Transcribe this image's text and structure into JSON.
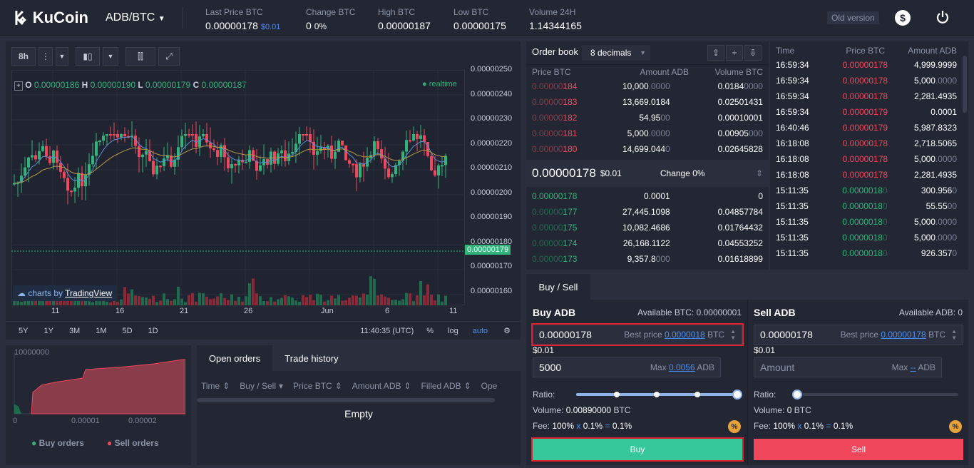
{
  "header": {
    "brand": "KuCoin",
    "pair": "ADB/BTC",
    "old_version": "Old version",
    "stats": [
      {
        "label": "Last Price BTC",
        "value": "0.00000178",
        "extra": "$0.01"
      },
      {
        "label": "Change BTC",
        "value": "0",
        "extra": "0%"
      },
      {
        "label": "High BTC",
        "value": "0.00000187"
      },
      {
        "label": "Low BTC",
        "value": "0.00000175"
      },
      {
        "label": "Volume 24H",
        "value": "1.14344165"
      }
    ]
  },
  "chart": {
    "interval": "8h",
    "ohlc": {
      "o": "0.00000186",
      "h": "0.00000190",
      "l": "0.00000179",
      "c": "0.00000187"
    },
    "realtime": "realtime",
    "credit": "charts by",
    "credit_link": "TradingView",
    "price_ticks": [
      "0.00000250",
      "0.00000240",
      "0.00000230",
      "0.00000220",
      "0.00000210",
      "0.00000200",
      "0.00000190",
      "0.00000180",
      "0.00000170",
      "0.00000160"
    ],
    "current_price": "0.00000179",
    "date_ticks": [
      "11",
      "16",
      "21",
      "26",
      "Jun",
      "6",
      "11"
    ],
    "ranges": [
      "5Y",
      "1Y",
      "3M",
      "1M",
      "5D",
      "1D"
    ],
    "clock": "11:40:35 (UTC)",
    "pct": "%",
    "log": "log",
    "auto": "auto"
  },
  "depth": {
    "ytick": "10000000",
    "xticks": [
      "0",
      "0.00001",
      "0.00002"
    ],
    "buy_label": "Buy orders",
    "sell_label": "Sell orders",
    "buy_color": "#31b37c",
    "sell_color": "#f0475d"
  },
  "orders": {
    "tabs": [
      "Open orders",
      "Trade history"
    ],
    "columns": [
      "Time",
      "Buy / Sell",
      "Price BTC",
      "Amount ADB",
      "Filled ADB",
      "Ope"
    ],
    "empty": "Empty"
  },
  "orderbook": {
    "title": "Order book",
    "decimals": "8 decimals",
    "columns": [
      "Price BTC",
      "Amount ADB",
      "Volume BTC"
    ],
    "asks": [
      {
        "p1": "0.00000",
        "p2": "184",
        "amount": "10,000",
        "afade": ".0000",
        "vol": "0.0184",
        "vfade": "0000"
      },
      {
        "p1": "0.00000",
        "p2": "183",
        "amount": "13,669.0184",
        "afade": "",
        "vol": "0.02501431",
        "vfade": ""
      },
      {
        "p1": "0.00000",
        "p2": "182",
        "amount": "54.95",
        "afade": "00",
        "vol": "0.00010001",
        "vfade": ""
      },
      {
        "p1": "0.00000",
        "p2": "181",
        "amount": "5,000",
        "afade": ".0000",
        "vol": "0.00905",
        "vfade": "000"
      },
      {
        "p1": "0.00000",
        "p2": "180",
        "amount": "14,699.044",
        "afade": "0",
        "vol": "0.02645828",
        "vfade": ""
      }
    ],
    "mid_price": "0.00000178",
    "mid_usd": "$0.01",
    "mid_change": "Change 0%",
    "bids": [
      {
        "p1": "0.00000178",
        "p2": "",
        "amount": "0.0001",
        "afade": "",
        "vol": "0",
        "vfade": ""
      },
      {
        "p1": "0.00000",
        "p2": "177",
        "amount": "27,445.1098",
        "afade": "",
        "vol": "0.04857784",
        "vfade": ""
      },
      {
        "p1": "0.00000",
        "p2": "175",
        "amount": "10,082.4686",
        "afade": "",
        "vol": "0.01764432",
        "vfade": ""
      },
      {
        "p1": "0.00000",
        "p2": "174",
        "amount": "26,168.1122",
        "afade": "",
        "vol": "0.04553252",
        "vfade": ""
      },
      {
        "p1": "0.00000",
        "p2": "173",
        "amount": "9,357.8",
        "afade": "000",
        "vol": "0.01618899",
        "vfade": ""
      }
    ]
  },
  "trades": {
    "columns": [
      "Time",
      "Price BTC",
      "Amount ADB"
    ],
    "rows": [
      {
        "t": "16:59:34",
        "p": "0.00000178",
        "pf": "",
        "a": "4,999.9999",
        "af": "",
        "side": "sell"
      },
      {
        "t": "16:59:34",
        "p": "0.00000178",
        "pf": "",
        "a": "5,000",
        "af": ".0000",
        "side": "sell"
      },
      {
        "t": "16:59:34",
        "p": "0.00000178",
        "pf": "",
        "a": "2,281.4935",
        "af": "",
        "side": "sell"
      },
      {
        "t": "16:59:34",
        "p": "0.00000179",
        "pf": "",
        "a": "0.0001",
        "af": "",
        "side": "sell"
      },
      {
        "t": "16:40:46",
        "p": "0.00000179",
        "pf": "",
        "a": "5,987.8323",
        "af": "",
        "side": "sell"
      },
      {
        "t": "16:18:08",
        "p": "0.00000178",
        "pf": "",
        "a": "2,718.5065",
        "af": "",
        "side": "sell"
      },
      {
        "t": "16:18:08",
        "p": "0.00000178",
        "pf": "",
        "a": "5,000",
        "af": ".0000",
        "side": "sell"
      },
      {
        "t": "16:18:08",
        "p": "0.00000178",
        "pf": "",
        "a": "2,281.4935",
        "af": "",
        "side": "sell"
      },
      {
        "t": "15:11:35",
        "p": "0.0000018",
        "pf": "0",
        "a": "300.956",
        "af": "0",
        "side": "buy"
      },
      {
        "t": "15:11:35",
        "p": "0.0000018",
        "pf": "0",
        "a": "55.55",
        "af": "00",
        "side": "buy"
      },
      {
        "t": "15:11:35",
        "p": "0.0000018",
        "pf": "0",
        "a": "5,000",
        "af": ".0000",
        "side": "buy"
      },
      {
        "t": "15:11:35",
        "p": "0.0000018",
        "pf": "0",
        "a": "5,000",
        "af": ".0000",
        "side": "buy"
      },
      {
        "t": "15:11:35",
        "p": "0.0000018",
        "pf": "0",
        "a": "926.357",
        "af": "0",
        "side": "buy"
      }
    ]
  },
  "buysell": {
    "tab": "Buy / Sell",
    "buy": {
      "title": "Buy ADB",
      "avail": "Available BTC: 0.00000001",
      "price": "0.00000178",
      "best_label": "Best price",
      "best": "0.0000018",
      "unit": "BTC",
      "usd": "$0.01",
      "amount": "5000",
      "max_label": "Max",
      "max": "0.0056",
      "aunit": "ADB",
      "ratio_label": "Ratio:",
      "ratio": 1.0,
      "vol_label": "Volume:",
      "vol": "0.00890000",
      "vol_unit": "BTC",
      "fee_label": "Fee:",
      "fee_a": "100%",
      "fee_x": "x",
      "fee_b": "0.1%",
      "fee_eq": "=",
      "fee_c": "0.1%",
      "button": "Buy"
    },
    "sell": {
      "title": "Sell ADB",
      "avail": "Available ADB: 0",
      "price": "0.00000178",
      "best_label": "Best price",
      "best": "0.00000178",
      "unit": "BTC",
      "usd": "$0.01",
      "amount_ph": "Amount",
      "max_label": "Max",
      "max": "--",
      "aunit": "ADB",
      "ratio_label": "Ratio:",
      "ratio": 0.0,
      "vol_label": "Volume:",
      "vol": "0",
      "vol_unit": "BTC",
      "fee_label": "Fee:",
      "fee_a": "100%",
      "fee_x": "x",
      "fee_b": "0.1%",
      "fee_eq": "=",
      "fee_c": "0.1%",
      "button": "Sell"
    }
  }
}
